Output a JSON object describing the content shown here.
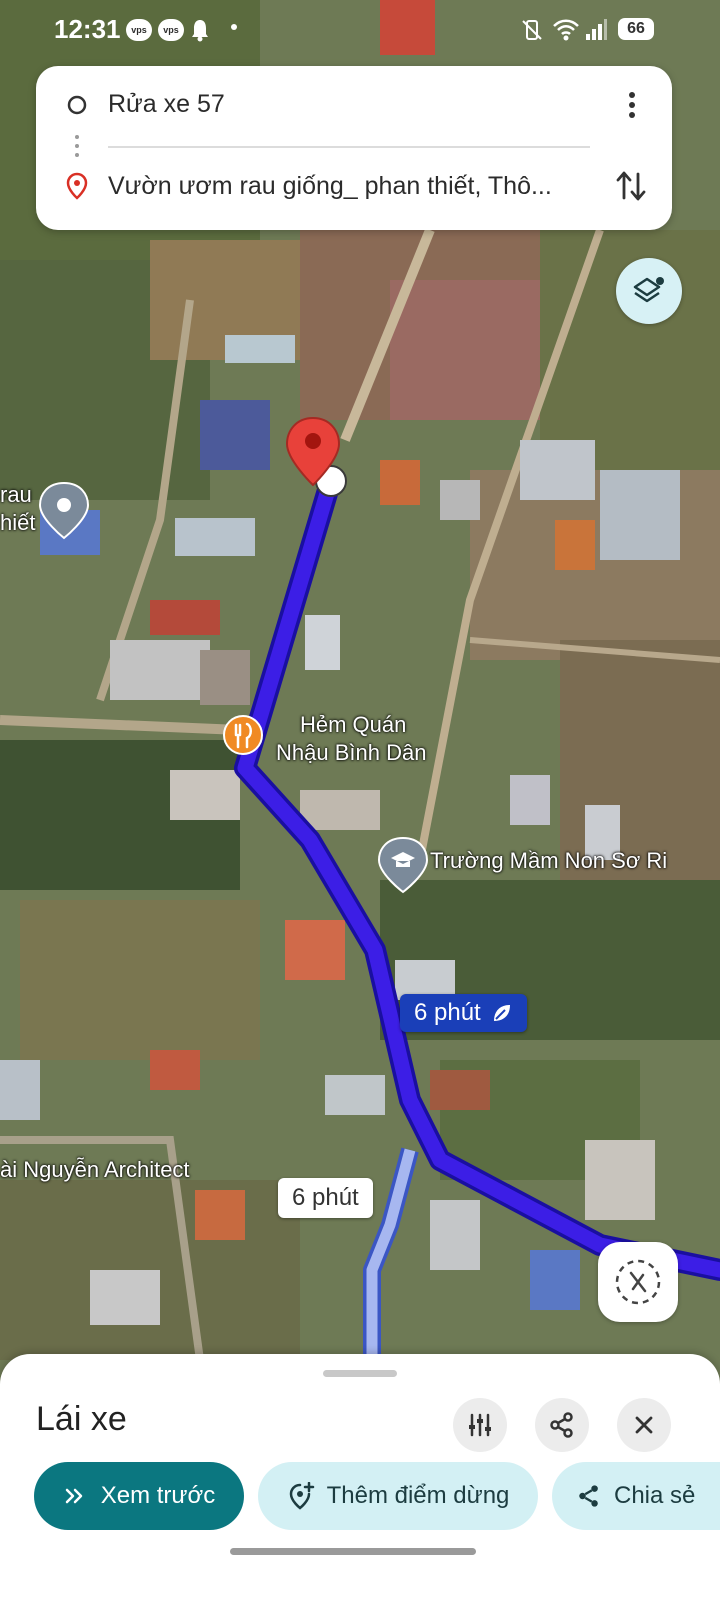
{
  "status_bar": {
    "time": "12:31",
    "badge_1": "vps",
    "badge_2": "vps",
    "battery": "66"
  },
  "route_card": {
    "origin": "Rửa xe 57",
    "destination": "Vườn ươm rau giống_ phan thiết, Thô..."
  },
  "map": {
    "poi_restaurant": {
      "line1": "Hẻm Quán",
      "line2": "Nhậu Bình Dân"
    },
    "poi_school": "Trường Mầm Non Sơ Ri",
    "poi_left_top": "rau",
    "poi_left_bottom": "hiết",
    "poi_architect": "ài Nguyễn Architect",
    "route_main_label": "6 phút",
    "route_alt_label": "6 phút"
  },
  "bottom_sheet": {
    "title": "Lái xe",
    "preview_label": "Xem trước",
    "add_stop_label": "Thêm điểm dừng",
    "share_label": "Chia sẻ"
  },
  "colors": {
    "route": "#3c1ee6",
    "route_alt": "#a7b7f0",
    "accent_teal": "#0b7780",
    "pill_light": "#d3f0f4",
    "pin_red": "#e8413a",
    "poi_orange": "#f08a24"
  }
}
